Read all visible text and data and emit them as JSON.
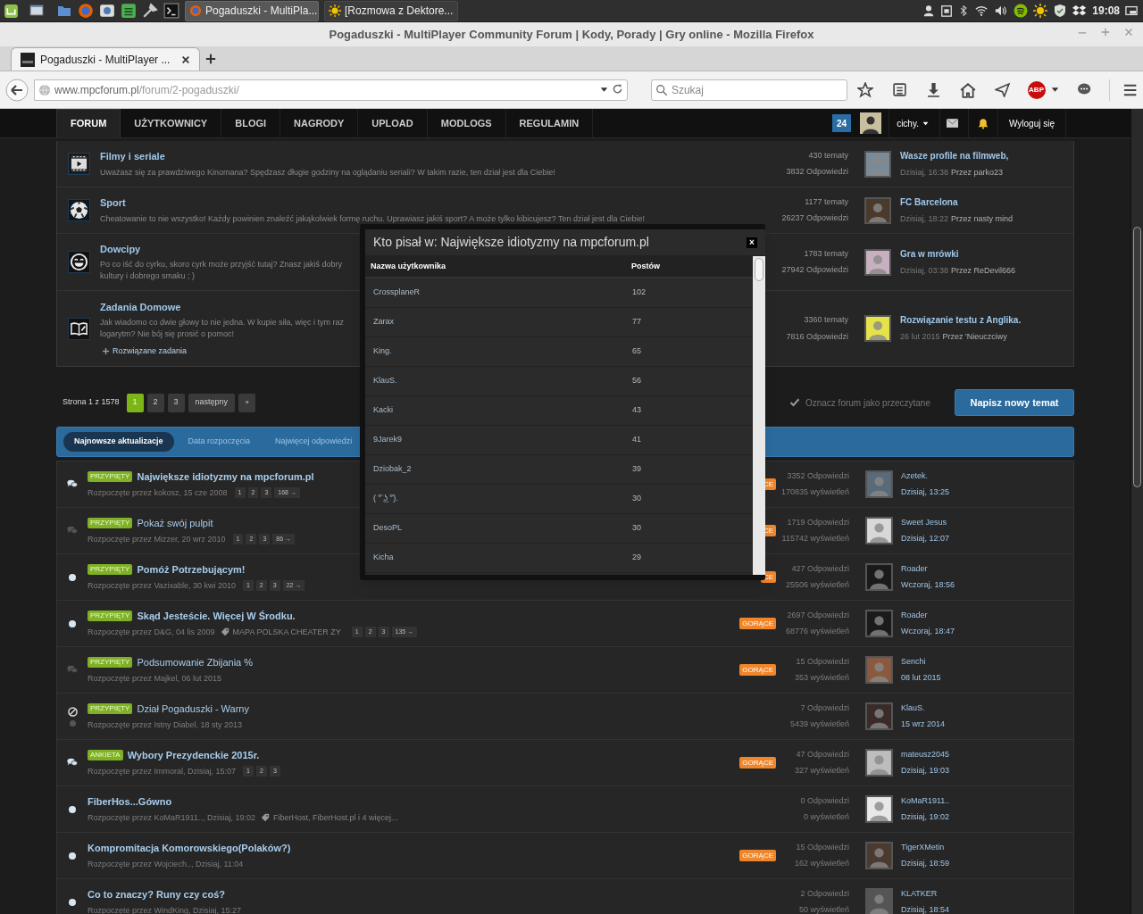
{
  "desktop_panel": {
    "tasks": [
      {
        "label": "Pogaduszki - MultiPla...",
        "selected": true
      },
      {
        "label": "[Rozmowa z Dektore...",
        "selected": false
      }
    ],
    "clock": "19:08"
  },
  "window": {
    "title": "Pogaduszki - MultiPlayer Community Forum | Kody, Porady | Gry online - Mozilla Firefox"
  },
  "browser": {
    "tabs": [
      {
        "label": "Pogaduszki - MultiPlayer ...",
        "selected": true
      }
    ],
    "url": {
      "domain": "www.mpcforum.pl",
      "path": "/forum/2-pogaduszki/"
    },
    "search": {
      "placeholder": "Szukaj"
    },
    "adblock_label": "ABP"
  },
  "forum_nav": {
    "tabs": [
      {
        "label": "FORUM",
        "selected": true
      },
      {
        "label": "UŻYTKOWNICY",
        "selected": false
      },
      {
        "label": "BLOGI",
        "selected": false
      },
      {
        "label": "NAGRODY",
        "selected": false
      },
      {
        "label": "UPLOAD",
        "selected": false
      },
      {
        "label": "MODLOGS",
        "selected": false
      },
      {
        "label": "REGULAMIN",
        "selected": false
      }
    ],
    "notifications": "24",
    "username": "cichy.",
    "logout": "Wyloguj się"
  },
  "forums": [
    {
      "title": "Filmy i seriale",
      "description_lines": [
        "Uważasz się za prawdziwego Kinomana? Spędzasz długie godziny na oglądaniu seriali? W takim razie, ten dział jest dla Ciebie!"
      ],
      "topics": "430 tematy",
      "replies": "3832 Odpowiedzi",
      "last_post": {
        "title": "Wasze profile na filmweb,",
        "date": "Dzisiaj, 16:38",
        "author": "Przez parko23"
      }
    },
    {
      "title": "Sport",
      "description_lines": [
        "Cheatowanie to nie wszystko! Każdy powinien znaleźć jakąkolwiek formę ruchu. Uprawiasz jakiś sport? A może tylko kibicujesz? Ten dział jest dla Ciebie!"
      ],
      "topics": "1177 tematy",
      "replies": "26237 Odpowiedzi",
      "last_post": {
        "title": "FC Barcelona",
        "date": "Dzisiaj, 18:22",
        "author": "Przez nasty mind"
      }
    },
    {
      "title": "Dowcipy",
      "description_lines": [
        "Po co iść do cyrku, skoro cyrk może przyjść tutaj? Znasz jakiś dobry",
        "kultury i dobrego smaku ; )"
      ],
      "topics": "1783 tematy",
      "replies": "27942 Odpowiedzi",
      "last_post": {
        "title": "Gra w mrówki",
        "date": "Dzisiaj, 03:38",
        "author": "Przez ReDevil666"
      }
    },
    {
      "title": "Zadania Domowe",
      "description_lines": [
        "Jak wiadomo co dwie głowy to nie jedna. W kupie siła, więc i tym raz",
        "logarytm? Nie bój się prosić o pomoc!"
      ],
      "subforum": "Rozwiązane zadania",
      "topics": "3360 tematy",
      "replies": "7816 Odpowiedzi",
      "last_post": {
        "title": "Rozwiązanie testu z Anglika.",
        "date": "26 lut 2015",
        "author": "Przez 'Nieuczciwy"
      }
    }
  ],
  "pagination": {
    "label": "Strona 1 z 1578",
    "pages": [
      {
        "label": "1",
        "selected": true
      },
      {
        "label": "2",
        "selected": false
      },
      {
        "label": "3",
        "selected": false
      }
    ],
    "next": "następny",
    "last": "»"
  },
  "mark_read": "Oznacz forum jako przeczytane",
  "new_topic": "Napisz nowy temat",
  "sort_tabs": [
    {
      "label": "Najnowsze aktualizacje",
      "selected": true
    },
    {
      "label": "Data rozpoczęcia",
      "selected": false
    },
    {
      "label": "Najwięcej odpowiedzi",
      "selected": false
    }
  ],
  "topics": [
    {
      "kind": "bubbles",
      "unread": true,
      "prefix": "PRZYPIĘTY",
      "title": "Największe idiotyzmy na mpcforum.pl",
      "started": "Rozpoczęte przez kokosz, 15 cze 2008",
      "pages": [
        "1",
        "2",
        "3",
        "168 →"
      ],
      "hot_label": "CE",
      "replies": "3352 Odpowiedzi",
      "views": "170835 wyświetleń",
      "last_user": "Azetek.",
      "last_date": "Dzisiaj, 13:25"
    },
    {
      "kind": "bubbles",
      "unread": false,
      "prefix": "PRZYPIĘTY",
      "title": "Pokaż swój pulpit",
      "started": "Rozpoczęte przez Mizzer, 20 wrz 2010",
      "pages": [
        "1",
        "2",
        "3",
        "86 →"
      ],
      "hot_label": "CE",
      "replies": "1719 Odpowiedzi",
      "views": "115742 wyświetleń",
      "last_user": "Sweet Jesus",
      "last_date": "Dzisiaj, 12:07"
    },
    {
      "kind": "dot",
      "unread": true,
      "prefix": "PRZYPIĘTY",
      "title": "Pomóż Potrzebującym!",
      "started": "Rozpoczęte przez Vazixable, 30 kwi 2010",
      "pages": [
        "1",
        "2",
        "3",
        "22 →"
      ],
      "hot_label": "CE",
      "replies": "427 Odpowiedzi",
      "views": "25506 wyświetleń",
      "last_user": "Roader",
      "last_date": "Wczoraj, 18:56"
    },
    {
      "kind": "dot",
      "unread": true,
      "prefix": "PRZYPIĘTY",
      "title": "Skąd Jesteście. Więcej W Środku.",
      "started": "Rozpoczęte przez D&G, 04 lis 2009",
      "tags": "MAPA POLSKA CHEATER ZY",
      "pages": [
        "1",
        "2",
        "3",
        "135 →"
      ],
      "hot_label": "GORĄCE",
      "replies": "2697 Odpowiedzi",
      "views": "68776 wyświetleń",
      "last_user": "Roader",
      "last_date": "Wczoraj, 18:47"
    },
    {
      "kind": "bubbles",
      "unread": false,
      "prefix": "PRZYPIĘTY",
      "title": "Podsumowanie Zbijania %",
      "started": "Rozpoczęte przez Majkel, 06 lut 2015",
      "hot_label": "GORĄCE",
      "replies": "15 Odpowiedzi",
      "views": "353 wyświetleń",
      "last_user": "Senchi",
      "last_date": "08 lut 2015"
    },
    {
      "kind": "locked",
      "unread": false,
      "prefix": "PRZYPIĘTY",
      "title": "Dział Pogaduszki - Warny",
      "started": "Rozpoczęte przez Istny Diabel, 18 sty 2013",
      "replies": "7 Odpowiedzi",
      "views": "5439 wyświetleń",
      "last_user": "KlauS.",
      "last_date": "15 wrz 2014"
    },
    {
      "kind": "bubbles",
      "unread": true,
      "prefix": "ANKIETA",
      "title": "Wybory Prezydenckie 2015r.",
      "started": "Rozpoczęte przez Immoral, Dzisiaj, 15:07",
      "pages": [
        "1",
        "2",
        "3"
      ],
      "hot_label": "GORĄCE",
      "replies": "47 Odpowiedzi",
      "views": "327 wyświetleń",
      "last_user": "mateusz2045",
      "last_date": "Dzisiaj, 19:03"
    },
    {
      "kind": "dot",
      "unread": true,
      "title": "FiberHos...Gówno",
      "started": "Rozpoczęte przez KoMaR1911.., Dzisiaj, 19:02",
      "tags": "FiberHost, FiberHost.pl i 4 więcej...",
      "replies": "0 Odpowiedzi",
      "views": "0 wyświetleń",
      "last_user": "KoMaR1911..",
      "last_date": "Dzisiaj, 19:02"
    },
    {
      "kind": "dot",
      "unread": true,
      "title": "Kompromitacja Komorowskiego(Polaków?)",
      "started": "Rozpoczęte przez Wojciech.., Dzisiaj, 11:04",
      "hot_label": "GORĄCE",
      "replies": "15 Odpowiedzi",
      "views": "162 wyświetleń",
      "last_user": "TigerXMetin",
      "last_date": "Dzisiaj, 18:59"
    },
    {
      "kind": "dot",
      "unread": true,
      "title": "Co to znaczy? Runy czy coś?",
      "started": "Rozpoczęte przez WindKing, Dzisiaj, 15:27",
      "replies": "2 Odpowiedzi",
      "views": "50 wyświetleń",
      "last_user": "KLATKER",
      "last_date": "Dzisiaj, 18:54"
    }
  ],
  "dialog": {
    "title": "Kto pisał w: Największe idiotyzmy na mpcforum.pl",
    "close": "×",
    "columns": [
      "Nazwa użytkownika",
      "Postów"
    ],
    "rows": [
      {
        "user": "CrossplaneR",
        "posts": "102"
      },
      {
        "user": "Zarax",
        "posts": "77"
      },
      {
        "user": "King.",
        "posts": "65"
      },
      {
        "user": "KlauS.",
        "posts": "56"
      },
      {
        "user": "Kacki",
        "posts": "43"
      },
      {
        "user": "9Jarek9",
        "posts": "41"
      },
      {
        "user": "Dziobak_2",
        "posts": "39"
      },
      {
        "user": "( ͡° ͜ʖ ͡°).",
        "posts": "30"
      },
      {
        "user": "DesoPL",
        "posts": "30"
      },
      {
        "user": "Kicha",
        "posts": "29"
      }
    ]
  }
}
